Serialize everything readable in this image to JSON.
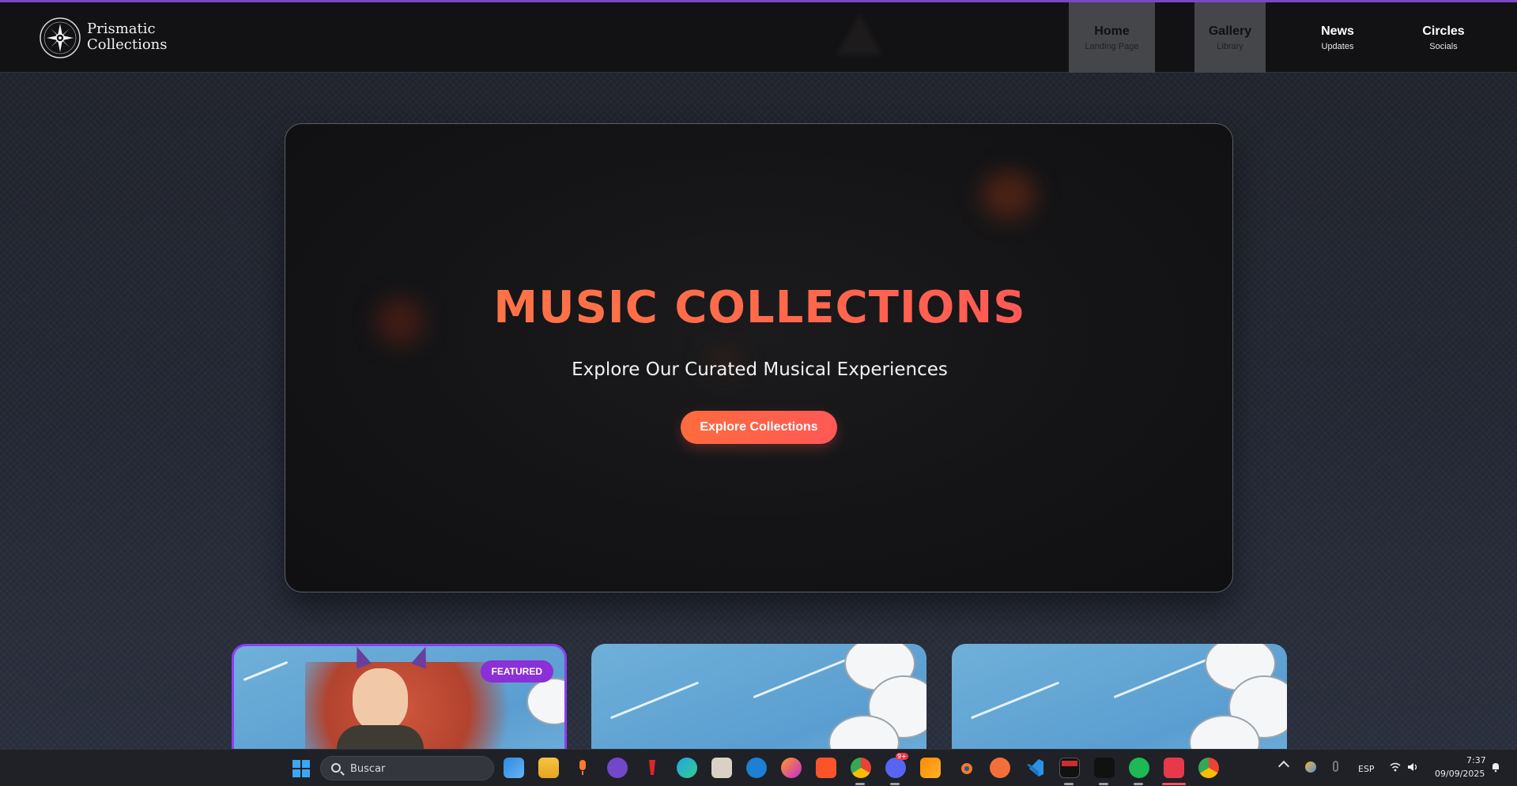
{
  "brand": {
    "line1": "Prismatic",
    "line2": "Collections"
  },
  "nav": [
    {
      "label": "Home",
      "sub": "Landing Page"
    },
    {
      "label": "Gallery",
      "sub": "Library"
    },
    {
      "label": "News",
      "sub": "Updates"
    },
    {
      "label": "Circles",
      "sub": "Socials"
    }
  ],
  "hero": {
    "title": "MUSIC COLLECTIONS",
    "subtitle": "Explore Our Curated Musical Experiences",
    "button": "Explore Collections"
  },
  "cards": [
    {
      "badge": "FEATURED"
    }
  ],
  "taskbar": {
    "search_placeholder": "Buscar",
    "language": "ESP",
    "time": "7:37",
    "date": "09/09/2025",
    "discord_badge": "9+"
  },
  "colors": {
    "accent_purple": "#8b2fd8",
    "hero_gradient_start": "#ff7a45",
    "hero_gradient_end": "#ff4d5f"
  }
}
